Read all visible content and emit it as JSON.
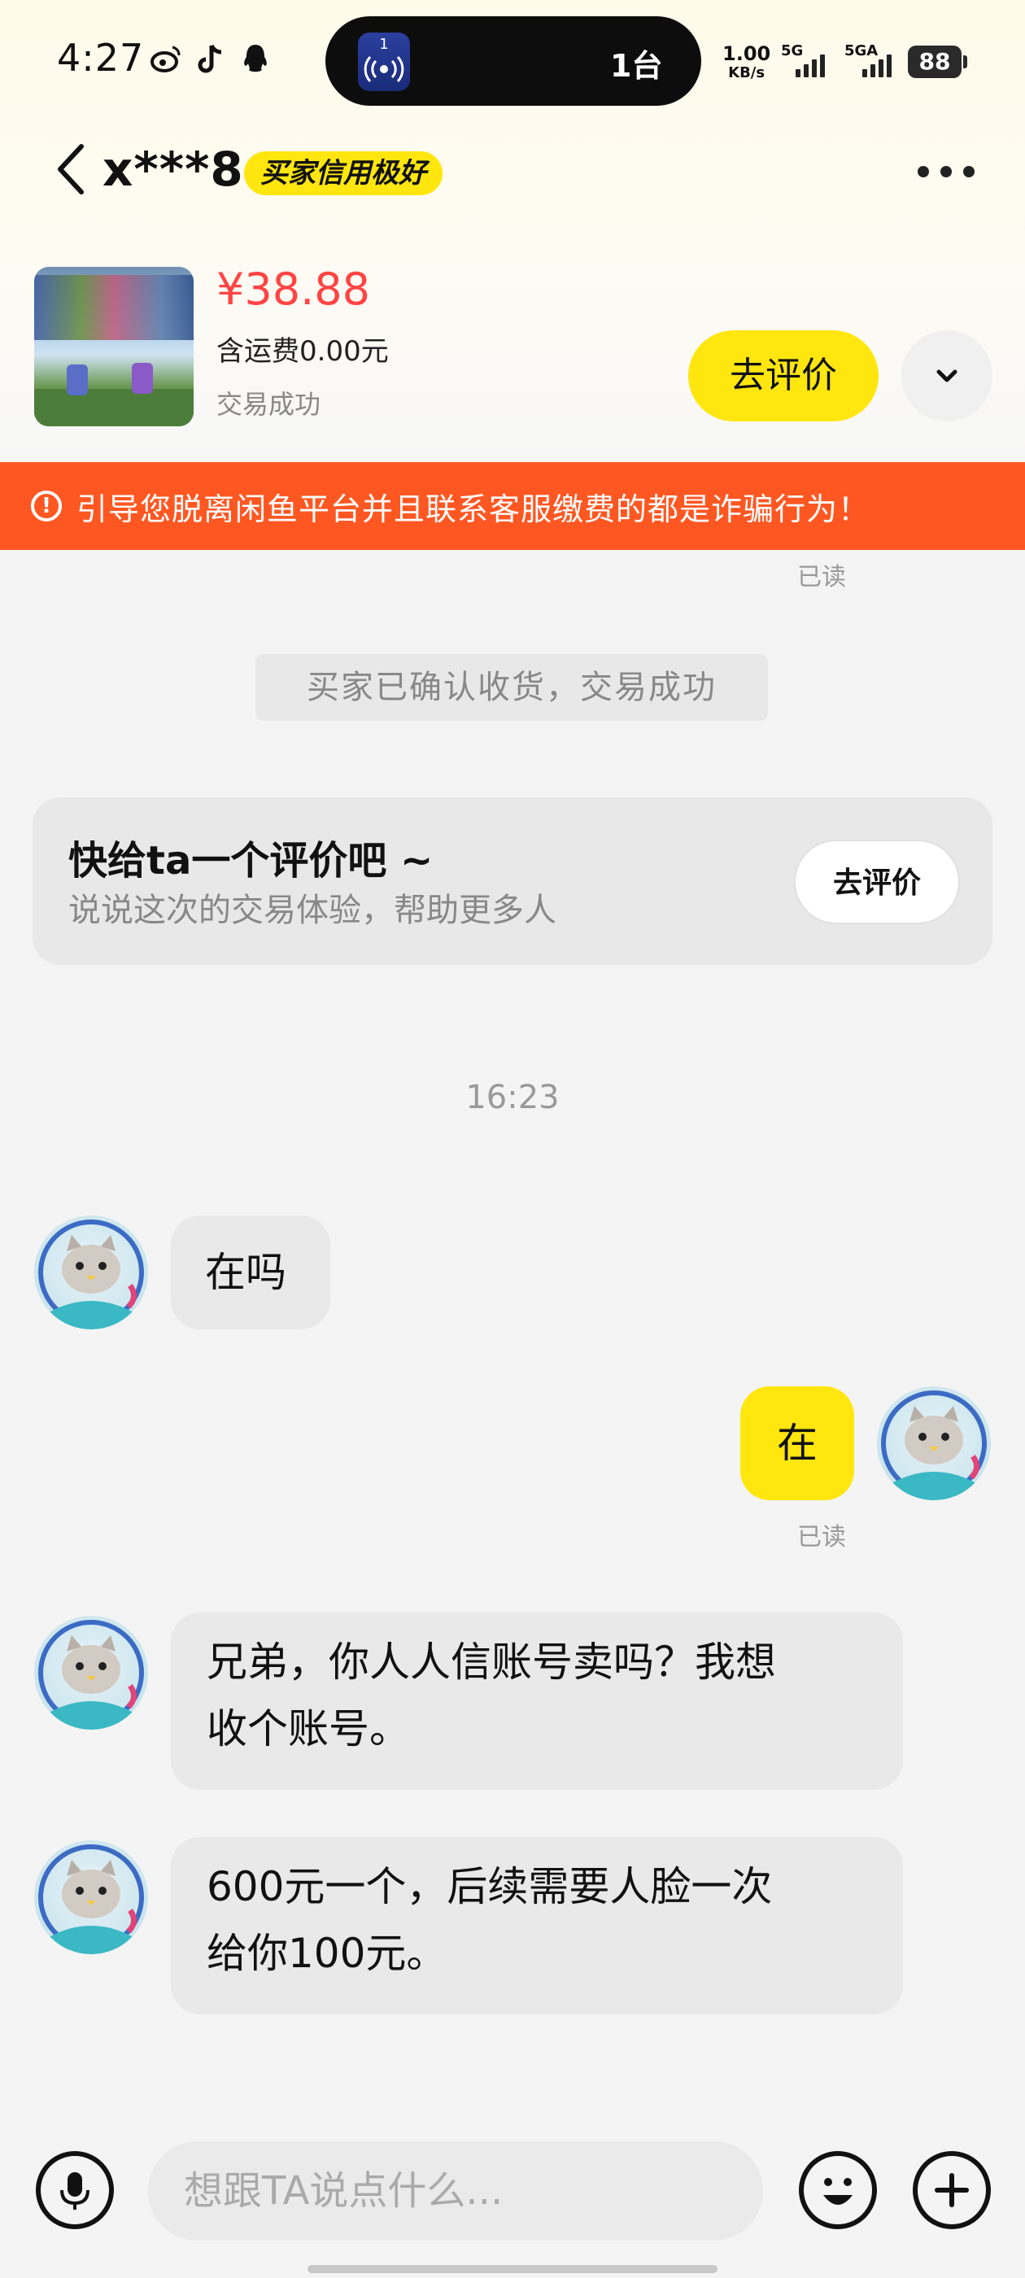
{
  "status_bar": {
    "time": "4:27",
    "island_app_badge": "1",
    "island_text": "1台",
    "net_speed_value": "1.00",
    "net_speed_unit": "KB/s",
    "signal1_label": "5G",
    "signal2_label": "5GA",
    "battery": "88"
  },
  "header": {
    "user_name": "x***8",
    "credit_badge": "买家信用极好"
  },
  "product": {
    "price": "¥38.88",
    "shipping": "含运费0.00元",
    "status": "交易成功",
    "review_button": "去评价"
  },
  "warning": {
    "text": "引导您脱离闲鱼平台并且联系客服缴费的都是诈骗行为！"
  },
  "chat": {
    "read_label": "已读",
    "system_message": "买家已确认收货，交易成功",
    "review_card": {
      "title": "快给ta一个评价吧 ~",
      "subtitle": "说说这次的交易体验，帮助更多人",
      "button": "去评价"
    },
    "timestamp": "16:23",
    "messages": [
      {
        "side": "in",
        "lines": [
          "在吗"
        ]
      },
      {
        "side": "out",
        "lines": [
          "在"
        ]
      },
      {
        "side": "in",
        "lines": [
          "兄弟，你人人信账号卖吗？我想",
          "收个账号。"
        ]
      },
      {
        "side": "in",
        "lines": [
          "600元一个，后续需要人脸一次",
          "给你100元。"
        ]
      }
    ]
  },
  "input": {
    "placeholder": "想跟TA说点什么..."
  },
  "colors": {
    "accent_yellow": "#ffe60f",
    "warning_orange": "#ff5722",
    "price_red": "#ff4444"
  }
}
